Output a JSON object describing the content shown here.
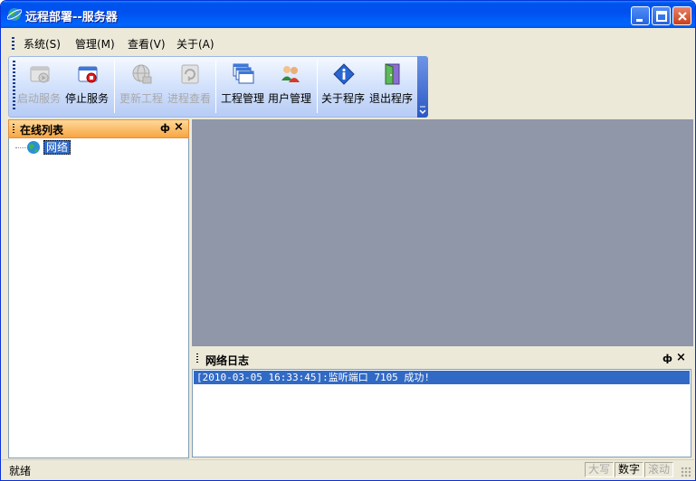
{
  "window": {
    "title": "远程部署--服务器"
  },
  "menu": {
    "items": [
      "系统(S)",
      "管理(M)",
      "查看(V)",
      "关于(A)"
    ]
  },
  "toolbar": {
    "start_service": "启动服务",
    "stop_service": "停止服务",
    "update_project": "更新工程",
    "process_view": "进程查看",
    "project_manage": "工程管理",
    "user_manage": "用户管理",
    "about_program": "关于程序",
    "exit_program": "退出程序"
  },
  "online_panel": {
    "title": "在线列表",
    "tree_root": "网络"
  },
  "log_panel": {
    "title": "网络日志",
    "entries": [
      "[2010-03-05 16:33:45]:监听端口 7105 成功!"
    ]
  },
  "statusbar": {
    "text": "就绪",
    "caps": "大写",
    "num": "数字",
    "scroll": "滚动"
  },
  "colors": {
    "title_bar": "#0053ee",
    "panel_header": "#f7a642",
    "selection": "#316ac5",
    "client_area": "#8f97a8"
  }
}
